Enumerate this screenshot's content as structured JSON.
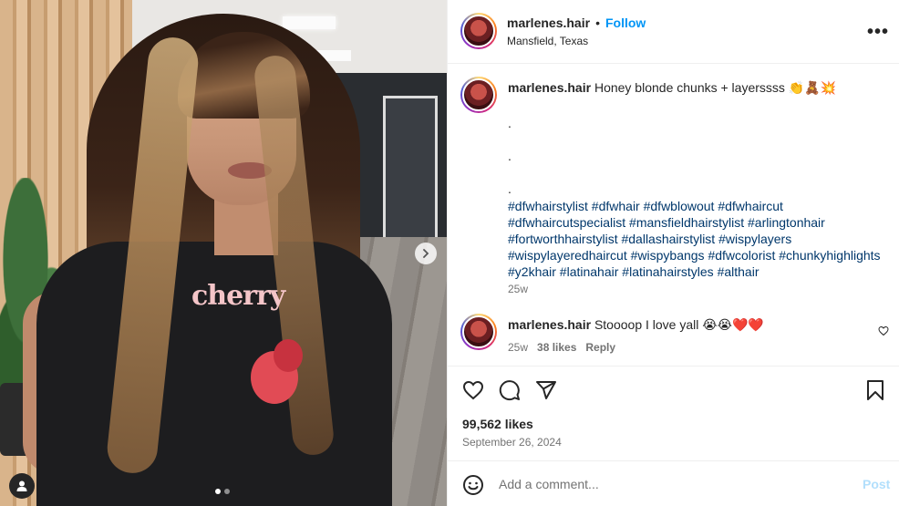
{
  "media": {
    "shirt_text": "cherry",
    "carousel_total": 2,
    "carousel_active": 0,
    "next_icon": "chevron-right-icon",
    "tag_icon": "user-tag-icon"
  },
  "header": {
    "username": "marlenes.hair",
    "separator": "•",
    "follow_label": "Follow",
    "location": "Mansfield, Texas",
    "more_icon": "more-options-icon",
    "more_glyph": "•••"
  },
  "caption": {
    "username": "marlenes.hair",
    "text": "Honey blonde chunks + layerssss 👏🧸💥",
    "dots": [
      ".",
      ".",
      "."
    ],
    "hashtags": "#dfwhairstylist #dfwhair #dfwblowout #dfwhaircut #dfwhaircutspecialist #mansfieldhairstylist #arlingtonhair #fortworthhairstylist #dallashairstylist #wispylayers #wispylayeredhaircut #wispybangs #dfwcolorist #chunkyhighlights #y2khair #latinahair #latinahairstyles #althair",
    "time": "25w"
  },
  "comment": {
    "username": "marlenes.hair",
    "text": "Stoooop I love yall 😭😭❤️❤️",
    "time": "25w",
    "likes": "38 likes",
    "reply_label": "Reply"
  },
  "actions": {
    "like_icon": "heart-icon",
    "comment_icon": "comment-icon",
    "share_icon": "share-icon",
    "save_icon": "bookmark-icon"
  },
  "likes": "99,562 likes",
  "date": "September 26, 2024",
  "add_comment": {
    "placeholder": "Add a comment...",
    "post_label": "Post",
    "emoji_icon": "emoji-icon"
  },
  "colors": {
    "follow": "#0095f6",
    "hashtag": "#00376b",
    "muted": "#737373",
    "post_disabled": "#b2dffc"
  }
}
